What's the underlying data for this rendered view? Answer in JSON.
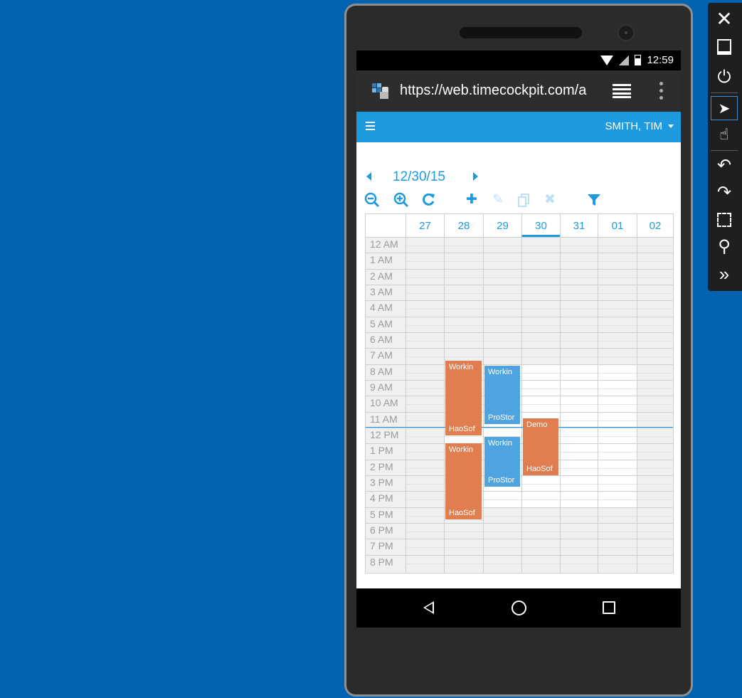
{
  "status_bar": {
    "time": "12:59"
  },
  "browser": {
    "url": "https://web.timecockpit.com/a"
  },
  "app_bar": {
    "user": "SMITH, TIM"
  },
  "date_nav": {
    "date": "12/30/15"
  },
  "toolbar": {
    "zoom_out": "zoom-out-icon",
    "zoom_in": "zoom-in-icon",
    "refresh": "refresh-icon",
    "add": "plus-icon",
    "edit": "pencil-icon",
    "copy": "copy-icon",
    "delete": "delete-icon",
    "filter": "filter-icon"
  },
  "calendar": {
    "days": [
      "27",
      "28",
      "29",
      "30",
      "31",
      "01",
      "02"
    ],
    "selected_day": "30",
    "hours": [
      "12 AM",
      "1 AM",
      "2 AM",
      "3 AM",
      "4 AM",
      "5 AM",
      "6 AM",
      "7 AM",
      "8 AM",
      "9 AM",
      "10 AM",
      "11 AM",
      "12 PM",
      "1 PM",
      "2 PM",
      "3 PM",
      "4 PM",
      "5 PM",
      "6 PM",
      "7 PM",
      "8 PM"
    ],
    "events": [
      {
        "title": "Workin",
        "subtitle": "HaoSof",
        "color": "#e17e50"
      },
      {
        "title": "Workin",
        "subtitle": "HaoSof",
        "color": "#e17e50"
      },
      {
        "title": "Workin",
        "subtitle": "ProStor",
        "color": "#4fa3df"
      },
      {
        "title": "Workin",
        "subtitle": "ProStor",
        "color": "#4fa3df"
      },
      {
        "title": "Demo",
        "subtitle": "HaoSof",
        "color": "#e17e50"
      }
    ]
  },
  "colors": {
    "accent": "#1e9be0",
    "desktop": "#0063b1",
    "event_orange": "#e17e50",
    "event_blue": "#4fa3df"
  }
}
